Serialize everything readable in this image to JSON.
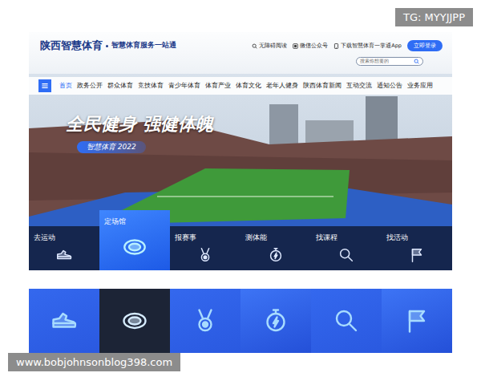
{
  "watermarks": {
    "top": "TG: MYYJJPP",
    "bottom": "www.bobjohnsonblog398.com"
  },
  "header": {
    "logo": "陕西智慧体育",
    "tagline": "智慧体育服务一站通",
    "links": [
      "无障碍阅读",
      "微信公众号",
      "下载智慧体育一掌通App"
    ],
    "login": "立即登录",
    "search": {
      "placeholder": "搜索你想要的"
    }
  },
  "nav": {
    "items": [
      {
        "label": "首页",
        "selected": true
      },
      {
        "label": "政务公开",
        "selected": false
      },
      {
        "label": "群众体育",
        "selected": false
      },
      {
        "label": "竞技体育",
        "selected": false
      },
      {
        "label": "青少年体育",
        "selected": false
      },
      {
        "label": "体育产业",
        "selected": false
      },
      {
        "label": "体育文化",
        "selected": false
      },
      {
        "label": "老年人健身",
        "selected": false
      },
      {
        "label": "陕西体育新闻",
        "selected": false
      },
      {
        "label": "互动交流",
        "selected": false
      },
      {
        "label": "通知公告",
        "selected": false
      },
      {
        "label": "业务应用",
        "selected": false
      }
    ]
  },
  "banner": {
    "slogan": "全民健身 强健体魄",
    "badge": "智慧体育 2022"
  },
  "services": [
    {
      "label": "去运动",
      "selected": false
    },
    {
      "label": "定场馆",
      "selected": true
    },
    {
      "label": "报赛事",
      "selected": false
    },
    {
      "label": "测体能",
      "selected": false
    },
    {
      "label": "找课程",
      "selected": false
    },
    {
      "label": "找活动",
      "selected": false
    }
  ],
  "preview_tiles": [
    {
      "selected": false
    },
    {
      "selected": true
    },
    {
      "selected": false
    },
    {
      "selected": false
    },
    {
      "selected": false
    },
    {
      "selected": false
    }
  ]
}
